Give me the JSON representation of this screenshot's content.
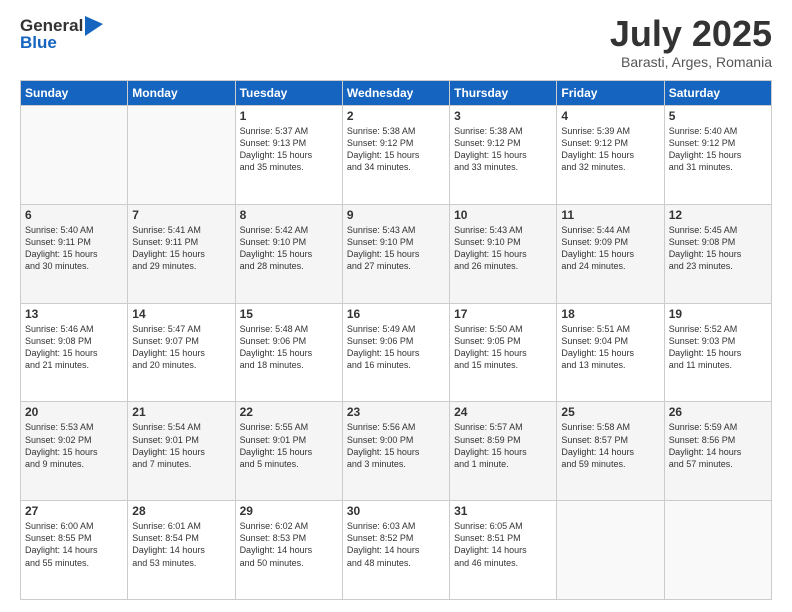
{
  "header": {
    "logo_line1": "General",
    "logo_line2": "Blue",
    "title": "July 2025",
    "location": "Barasti, Arges, Romania"
  },
  "days_of_week": [
    "Sunday",
    "Monday",
    "Tuesday",
    "Wednesday",
    "Thursday",
    "Friday",
    "Saturday"
  ],
  "weeks": [
    [
      {
        "day": "",
        "detail": ""
      },
      {
        "day": "",
        "detail": ""
      },
      {
        "day": "1",
        "detail": "Sunrise: 5:37 AM\nSunset: 9:13 PM\nDaylight: 15 hours\nand 35 minutes."
      },
      {
        "day": "2",
        "detail": "Sunrise: 5:38 AM\nSunset: 9:12 PM\nDaylight: 15 hours\nand 34 minutes."
      },
      {
        "day": "3",
        "detail": "Sunrise: 5:38 AM\nSunset: 9:12 PM\nDaylight: 15 hours\nand 33 minutes."
      },
      {
        "day": "4",
        "detail": "Sunrise: 5:39 AM\nSunset: 9:12 PM\nDaylight: 15 hours\nand 32 minutes."
      },
      {
        "day": "5",
        "detail": "Sunrise: 5:40 AM\nSunset: 9:12 PM\nDaylight: 15 hours\nand 31 minutes."
      }
    ],
    [
      {
        "day": "6",
        "detail": "Sunrise: 5:40 AM\nSunset: 9:11 PM\nDaylight: 15 hours\nand 30 minutes."
      },
      {
        "day": "7",
        "detail": "Sunrise: 5:41 AM\nSunset: 9:11 PM\nDaylight: 15 hours\nand 29 minutes."
      },
      {
        "day": "8",
        "detail": "Sunrise: 5:42 AM\nSunset: 9:10 PM\nDaylight: 15 hours\nand 28 minutes."
      },
      {
        "day": "9",
        "detail": "Sunrise: 5:43 AM\nSunset: 9:10 PM\nDaylight: 15 hours\nand 27 minutes."
      },
      {
        "day": "10",
        "detail": "Sunrise: 5:43 AM\nSunset: 9:10 PM\nDaylight: 15 hours\nand 26 minutes."
      },
      {
        "day": "11",
        "detail": "Sunrise: 5:44 AM\nSunset: 9:09 PM\nDaylight: 15 hours\nand 24 minutes."
      },
      {
        "day": "12",
        "detail": "Sunrise: 5:45 AM\nSunset: 9:08 PM\nDaylight: 15 hours\nand 23 minutes."
      }
    ],
    [
      {
        "day": "13",
        "detail": "Sunrise: 5:46 AM\nSunset: 9:08 PM\nDaylight: 15 hours\nand 21 minutes."
      },
      {
        "day": "14",
        "detail": "Sunrise: 5:47 AM\nSunset: 9:07 PM\nDaylight: 15 hours\nand 20 minutes."
      },
      {
        "day": "15",
        "detail": "Sunrise: 5:48 AM\nSunset: 9:06 PM\nDaylight: 15 hours\nand 18 minutes."
      },
      {
        "day": "16",
        "detail": "Sunrise: 5:49 AM\nSunset: 9:06 PM\nDaylight: 15 hours\nand 16 minutes."
      },
      {
        "day": "17",
        "detail": "Sunrise: 5:50 AM\nSunset: 9:05 PM\nDaylight: 15 hours\nand 15 minutes."
      },
      {
        "day": "18",
        "detail": "Sunrise: 5:51 AM\nSunset: 9:04 PM\nDaylight: 15 hours\nand 13 minutes."
      },
      {
        "day": "19",
        "detail": "Sunrise: 5:52 AM\nSunset: 9:03 PM\nDaylight: 15 hours\nand 11 minutes."
      }
    ],
    [
      {
        "day": "20",
        "detail": "Sunrise: 5:53 AM\nSunset: 9:02 PM\nDaylight: 15 hours\nand 9 minutes."
      },
      {
        "day": "21",
        "detail": "Sunrise: 5:54 AM\nSunset: 9:01 PM\nDaylight: 15 hours\nand 7 minutes."
      },
      {
        "day": "22",
        "detail": "Sunrise: 5:55 AM\nSunset: 9:01 PM\nDaylight: 15 hours\nand 5 minutes."
      },
      {
        "day": "23",
        "detail": "Sunrise: 5:56 AM\nSunset: 9:00 PM\nDaylight: 15 hours\nand 3 minutes."
      },
      {
        "day": "24",
        "detail": "Sunrise: 5:57 AM\nSunset: 8:59 PM\nDaylight: 15 hours\nand 1 minute."
      },
      {
        "day": "25",
        "detail": "Sunrise: 5:58 AM\nSunset: 8:57 PM\nDaylight: 14 hours\nand 59 minutes."
      },
      {
        "day": "26",
        "detail": "Sunrise: 5:59 AM\nSunset: 8:56 PM\nDaylight: 14 hours\nand 57 minutes."
      }
    ],
    [
      {
        "day": "27",
        "detail": "Sunrise: 6:00 AM\nSunset: 8:55 PM\nDaylight: 14 hours\nand 55 minutes."
      },
      {
        "day": "28",
        "detail": "Sunrise: 6:01 AM\nSunset: 8:54 PM\nDaylight: 14 hours\nand 53 minutes."
      },
      {
        "day": "29",
        "detail": "Sunrise: 6:02 AM\nSunset: 8:53 PM\nDaylight: 14 hours\nand 50 minutes."
      },
      {
        "day": "30",
        "detail": "Sunrise: 6:03 AM\nSunset: 8:52 PM\nDaylight: 14 hours\nand 48 minutes."
      },
      {
        "day": "31",
        "detail": "Sunrise: 6:05 AM\nSunset: 8:51 PM\nDaylight: 14 hours\nand 46 minutes."
      },
      {
        "day": "",
        "detail": ""
      },
      {
        "day": "",
        "detail": ""
      }
    ]
  ]
}
